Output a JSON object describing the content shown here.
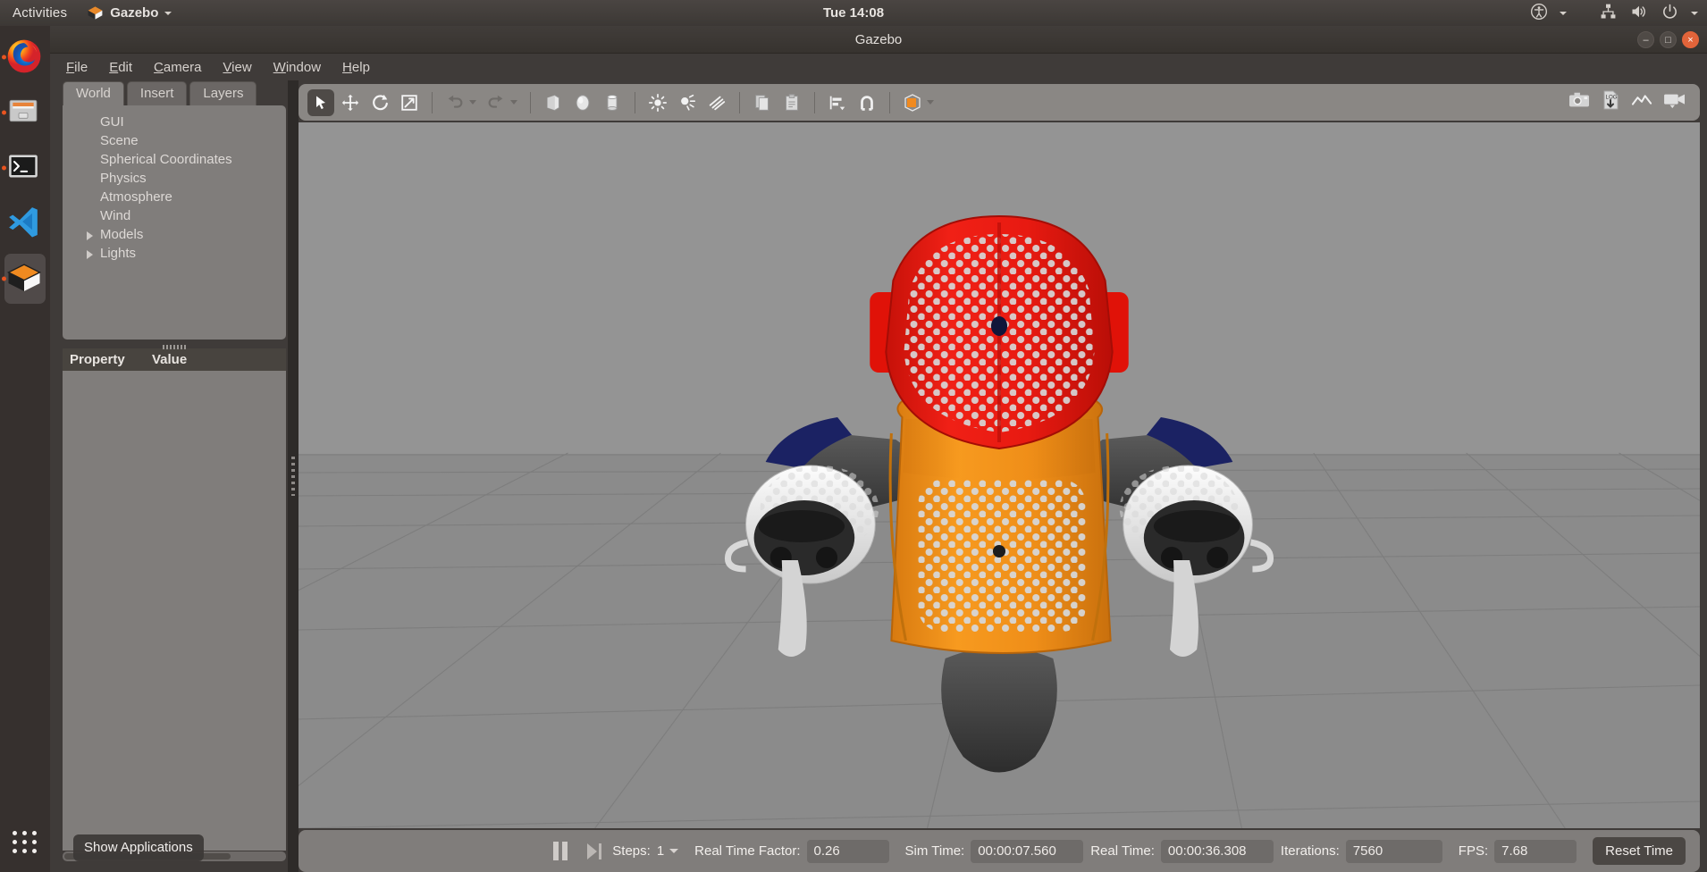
{
  "topbar": {
    "activities": "Activities",
    "app_name": "Gazebo",
    "app_icon": "gazebo-cube-icon",
    "clock": "Tue 14:08",
    "tray": [
      {
        "name": "accessibility-icon",
        "label": "Accessibility"
      },
      {
        "name": "network-icon",
        "label": "Network"
      },
      {
        "name": "volume-icon",
        "label": "Volume"
      },
      {
        "name": "power-icon",
        "label": "Power"
      }
    ]
  },
  "dock": {
    "items": [
      {
        "name": "dock-item-firefox",
        "label": "Firefox",
        "running": true,
        "active": false
      },
      {
        "name": "dock-item-files",
        "label": "Files",
        "running": true,
        "active": false
      },
      {
        "name": "dock-item-terminal",
        "label": "Terminal",
        "running": true,
        "active": false
      },
      {
        "name": "dock-item-vscode",
        "label": "Visual Studio Code",
        "running": false,
        "active": false
      },
      {
        "name": "dock-item-gazebo",
        "label": "Gazebo",
        "running": true,
        "active": true
      }
    ],
    "show_applications": "Show Applications"
  },
  "window": {
    "title": "Gazebo",
    "minimize": "–",
    "maximize": "□",
    "close": "×"
  },
  "menubar": [
    {
      "label": "File",
      "mnemonic": "F"
    },
    {
      "label": "Edit",
      "mnemonic": "E"
    },
    {
      "label": "Camera",
      "mnemonic": "C"
    },
    {
      "label": "View",
      "mnemonic": "V"
    },
    {
      "label": "Window",
      "mnemonic": "W"
    },
    {
      "label": "Help",
      "mnemonic": "H"
    }
  ],
  "left_panel": {
    "tabs": [
      {
        "label": "World",
        "active": true
      },
      {
        "label": "Insert",
        "active": false
      },
      {
        "label": "Layers",
        "active": false
      }
    ],
    "tree": [
      {
        "label": "GUI",
        "expandable": false
      },
      {
        "label": "Scene",
        "expandable": false
      },
      {
        "label": "Spherical Coordinates",
        "expandable": false
      },
      {
        "label": "Physics",
        "expandable": false
      },
      {
        "label": "Atmosphere",
        "expandable": false
      },
      {
        "label": "Wind",
        "expandable": false
      },
      {
        "label": "Models",
        "expandable": true
      },
      {
        "label": "Lights",
        "expandable": true
      }
    ],
    "property_header": {
      "property": "Property",
      "value": "Value"
    }
  },
  "toolbar": {
    "left_tools": [
      {
        "name": "select-mode-icon",
        "label": "Selection Mode",
        "active": true
      },
      {
        "name": "translate-mode-icon",
        "label": "Translation Mode",
        "active": false
      },
      {
        "name": "rotate-mode-icon",
        "label": "Rotation Mode",
        "active": false
      },
      {
        "name": "scale-mode-icon",
        "label": "Scale Mode",
        "active": false
      },
      {
        "name": "undo-icon",
        "label": "Undo",
        "active": false
      },
      {
        "name": "redo-icon",
        "label": "Redo",
        "active": false
      },
      {
        "name": "box-icon",
        "label": "Box",
        "active": false
      },
      {
        "name": "sphere-icon",
        "label": "Sphere",
        "active": false
      },
      {
        "name": "cylinder-icon",
        "label": "Cylinder",
        "active": false
      },
      {
        "name": "point-light-icon",
        "label": "Point Light",
        "active": false
      },
      {
        "name": "spot-light-icon",
        "label": "Spot Light",
        "active": false
      },
      {
        "name": "directional-light-icon",
        "label": "Directional Light",
        "active": false
      },
      {
        "name": "copy-icon",
        "label": "Copy",
        "active": false
      },
      {
        "name": "paste-icon",
        "label": "Paste",
        "active": false
      },
      {
        "name": "align-icon",
        "label": "Align",
        "active": false
      },
      {
        "name": "snap-icon",
        "label": "Snap",
        "active": false
      },
      {
        "name": "view-mode-icon",
        "label": "Change the view",
        "active": false
      }
    ],
    "right_tools": [
      {
        "name": "screenshot-icon",
        "label": "Take a screenshot"
      },
      {
        "name": "log-download-icon",
        "label": "Data Logger"
      },
      {
        "name": "plot-icon",
        "label": "Plotting Utility"
      },
      {
        "name": "record-video-icon",
        "label": "Record a video"
      }
    ]
  },
  "statusbar": {
    "pause_icon": "pause-icon",
    "step_icon": "step-forward-icon",
    "steps_label": "Steps:",
    "steps_value": "1",
    "real_time_factor_label": "Real Time Factor:",
    "real_time_factor_value": "0.26",
    "sim_time_label": "Sim Time:",
    "sim_time_value": "00:00:07.560",
    "real_time_label": "Real Time:",
    "real_time_value": "00:00:36.308",
    "iterations_label": "Iterations:",
    "iterations_value": "7560",
    "fps_label": "FPS:",
    "fps_value": "7.68",
    "reset_time_label": "Reset Time"
  },
  "scene": {
    "description": "3D simulation viewport showing a humanoid robot viewed from above on an infinite ground plane grid",
    "model_name": "humanoid-robot",
    "colors": {
      "head": "#e21a12",
      "torso": "#f0921a",
      "shoulder": "#1b2263",
      "arm_dark": "#4d4d4d",
      "arm_white": "#f2f2f2",
      "ground": "#8b8b8b",
      "sky": "#949494",
      "grid_line": "#7b7b7b"
    }
  }
}
